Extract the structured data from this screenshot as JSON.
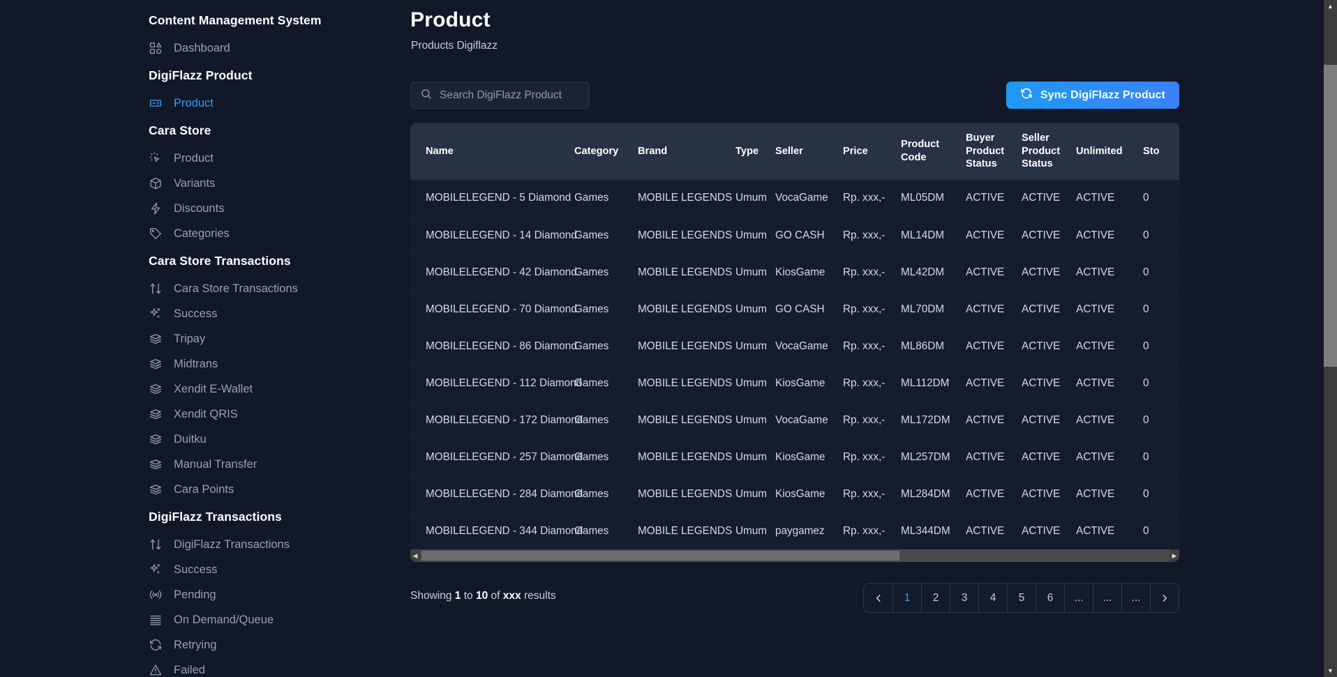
{
  "sidebar": {
    "groups": [
      {
        "title": "Content Management System",
        "items": [
          {
            "label": "Dashboard",
            "icon": "grid-dashboard-icon",
            "active": false
          }
        ]
      },
      {
        "title": "DigiFlazz Product",
        "items": [
          {
            "label": "Product",
            "icon": "ticket-icon",
            "active": true
          }
        ]
      },
      {
        "title": "Cara Store",
        "items": [
          {
            "label": "Product",
            "icon": "cursor-click-icon",
            "active": false
          },
          {
            "label": "Variants",
            "icon": "cube-icon",
            "active": false
          },
          {
            "label": "Discounts",
            "icon": "bolt-icon",
            "active": false
          },
          {
            "label": "Categories",
            "icon": "tag-icon",
            "active": false
          }
        ]
      },
      {
        "title": "Cara Store Transactions",
        "items": [
          {
            "label": "Cara Store Transactions",
            "icon": "arrows-up-down-icon",
            "active": false
          },
          {
            "label": "Success",
            "icon": "sparkles-icon",
            "active": false
          },
          {
            "label": "Tripay",
            "icon": "server-stack-icon",
            "active": false
          },
          {
            "label": "Midtrans",
            "icon": "server-stack-icon",
            "active": false
          },
          {
            "label": "Xendit E-Wallet",
            "icon": "server-stack-icon",
            "active": false
          },
          {
            "label": "Xendit QRIS",
            "icon": "server-stack-icon",
            "active": false
          },
          {
            "label": "Duitku",
            "icon": "server-stack-icon",
            "active": false
          },
          {
            "label": "Manual Transfer",
            "icon": "server-stack-icon",
            "active": false
          },
          {
            "label": "Cara Points",
            "icon": "server-stack-icon",
            "active": false
          }
        ]
      },
      {
        "title": "DigiFlazz Transactions",
        "items": [
          {
            "label": "DigiFlazz Transactions",
            "icon": "arrows-up-down-icon",
            "active": false
          },
          {
            "label": "Success",
            "icon": "sparkles-icon",
            "active": false
          },
          {
            "label": "Pending",
            "icon": "signal-icon",
            "active": false
          },
          {
            "label": "On Demand/Queue",
            "icon": "queue-list-icon",
            "active": false
          },
          {
            "label": "Retrying",
            "icon": "arrow-path-icon",
            "active": false
          },
          {
            "label": "Failed",
            "icon": "warning-triangle-icon",
            "active": false
          }
        ]
      }
    ]
  },
  "header": {
    "title": "Product",
    "subtitle": "Products Digiflazz"
  },
  "toolbar": {
    "search_placeholder": "Search DigiFlazz Product",
    "search_value": "",
    "search_icon": "search-icon",
    "sync_label": "Sync DigiFlazz Product",
    "sync_icon": "refresh-icon",
    "sync_color": "#1e9af3"
  },
  "table": {
    "columns": [
      "Name",
      "Category",
      "Brand",
      "Type",
      "Seller",
      "Price",
      "Product Code",
      "Buyer Product Status",
      "Seller Product Status",
      "Unlimited",
      "Sto"
    ],
    "rows": [
      {
        "name": "MOBILELEGEND - 5 Diamond",
        "category": "Games",
        "brand": "MOBILE LEGENDS",
        "type": "Umum",
        "seller": "VocaGame",
        "price": "Rp. xxx,-",
        "code": "ML05DM",
        "buyer_status": "ACTIVE",
        "seller_status": "ACTIVE",
        "unlimited": "ACTIVE",
        "stock": "0"
      },
      {
        "name": "MOBILELEGEND - 14 Diamond",
        "category": "Games",
        "brand": "MOBILE LEGENDS",
        "type": "Umum",
        "seller": "GO CASH",
        "price": "Rp. xxx,-",
        "code": "ML14DM",
        "buyer_status": "ACTIVE",
        "seller_status": "ACTIVE",
        "unlimited": "ACTIVE",
        "stock": "0"
      },
      {
        "name": "MOBILELEGEND - 42 Diamond",
        "category": "Games",
        "brand": "MOBILE LEGENDS",
        "type": "Umum",
        "seller": "KiosGame",
        "price": "Rp. xxx,-",
        "code": "ML42DM",
        "buyer_status": "ACTIVE",
        "seller_status": "ACTIVE",
        "unlimited": "ACTIVE",
        "stock": "0"
      },
      {
        "name": "MOBILELEGEND - 70 Diamond",
        "category": "Games",
        "brand": "MOBILE LEGENDS",
        "type": "Umum",
        "seller": "GO CASH",
        "price": "Rp. xxx,-",
        "code": "ML70DM",
        "buyer_status": "ACTIVE",
        "seller_status": "ACTIVE",
        "unlimited": "ACTIVE",
        "stock": "0"
      },
      {
        "name": "MOBILELEGEND - 86 Diamond",
        "category": "Games",
        "brand": "MOBILE LEGENDS",
        "type": "Umum",
        "seller": "VocaGame",
        "price": "Rp. xxx,-",
        "code": "ML86DM",
        "buyer_status": "ACTIVE",
        "seller_status": "ACTIVE",
        "unlimited": "ACTIVE",
        "stock": "0"
      },
      {
        "name": "MOBILELEGEND - 112 Diamond",
        "category": "Games",
        "brand": "MOBILE LEGENDS",
        "type": "Umum",
        "seller": "KiosGame",
        "price": "Rp. xxx,-",
        "code": "ML112DM",
        "buyer_status": "ACTIVE",
        "seller_status": "ACTIVE",
        "unlimited": "ACTIVE",
        "stock": "0"
      },
      {
        "name": "MOBILELEGEND - 172 Diamond",
        "category": "Games",
        "brand": "MOBILE LEGENDS",
        "type": "Umum",
        "seller": "VocaGame",
        "price": "Rp. xxx,-",
        "code": "ML172DM",
        "buyer_status": "ACTIVE",
        "seller_status": "ACTIVE",
        "unlimited": "ACTIVE",
        "stock": "0"
      },
      {
        "name": "MOBILELEGEND - 257 Diamond",
        "category": "Games",
        "brand": "MOBILE LEGENDS",
        "type": "Umum",
        "seller": "KiosGame",
        "price": "Rp. xxx,-",
        "code": "ML257DM",
        "buyer_status": "ACTIVE",
        "seller_status": "ACTIVE",
        "unlimited": "ACTIVE",
        "stock": "0"
      },
      {
        "name": "MOBILELEGEND - 284 Diamond",
        "category": "Games",
        "brand": "MOBILE LEGENDS",
        "type": "Umum",
        "seller": "KiosGame",
        "price": "Rp. xxx,-",
        "code": "ML284DM",
        "buyer_status": "ACTIVE",
        "seller_status": "ACTIVE",
        "unlimited": "ACTIVE",
        "stock": "0"
      },
      {
        "name": "MOBILELEGEND - 344 Diamond",
        "category": "Games",
        "brand": "MOBILE LEGENDS",
        "type": "Umum",
        "seller": "paygamez",
        "price": "Rp. xxx,-",
        "code": "ML344DM",
        "buyer_status": "ACTIVE",
        "seller_status": "ACTIVE",
        "unlimited": "ACTIVE",
        "stock": "0"
      }
    ]
  },
  "footer": {
    "showing_prefix": "Showing",
    "showing_from": "1",
    "showing_to_word": "to",
    "showing_to": "10",
    "showing_of_word": "of",
    "showing_total": "xxx",
    "showing_suffix": "results",
    "pagination": [
      {
        "label": "‹",
        "type": "prev",
        "current": false
      },
      {
        "label": "1",
        "type": "page",
        "current": true
      },
      {
        "label": "2",
        "type": "page",
        "current": false
      },
      {
        "label": "3",
        "type": "page",
        "current": false
      },
      {
        "label": "4",
        "type": "page",
        "current": false
      },
      {
        "label": "5",
        "type": "page",
        "current": false
      },
      {
        "label": "6",
        "type": "page",
        "current": false
      },
      {
        "label": "...",
        "type": "ellipsis",
        "current": false
      },
      {
        "label": "...",
        "type": "ellipsis",
        "current": false
      },
      {
        "label": "...",
        "type": "ellipsis",
        "current": false
      },
      {
        "label": "›",
        "type": "next",
        "current": false
      }
    ]
  },
  "colors": {
    "background": "#111827",
    "card": "#141d2e",
    "table_header": "#273245",
    "accent": "#3b9dfb",
    "muted_text": "#94a3b8"
  }
}
